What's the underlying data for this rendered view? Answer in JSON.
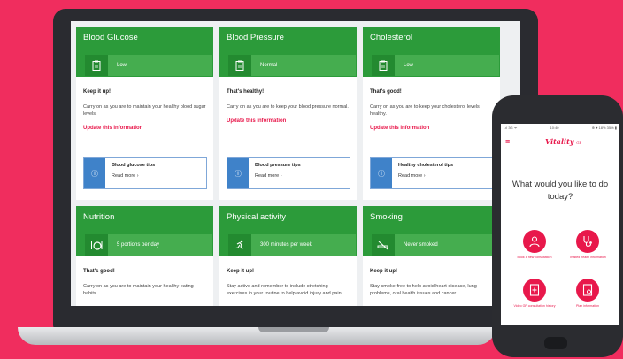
{
  "colors": {
    "background": "#f02d5e",
    "green": "#2c9b3a",
    "accent": "#e8184b",
    "tip_blue": "#3f82c9"
  },
  "cards": [
    {
      "title": "Blood Glucose",
      "status": "Low",
      "icon": "clipboard-icon",
      "msg_title": "Keep it up!",
      "msg_text": "Carry on as you are to maintain your healthy blood sugar levels.",
      "update": "Update this information",
      "tip_title": "Blood glucose tips",
      "tip_link": "Read more ›"
    },
    {
      "title": "Blood Pressure",
      "status": "Normal",
      "icon": "clipboard-icon",
      "msg_title": "That's healthy!",
      "msg_text": "Carry on as you are to keep your blood pressure normal.",
      "update": "Update this information",
      "tip_title": "Blood pressure tips",
      "tip_link": "Read more ›"
    },
    {
      "title": "Cholesterol",
      "status": "Low",
      "icon": "clipboard-icon",
      "msg_title": "That's good!",
      "msg_text": "Carry on as you are to keep your cholesterol levels healthy.",
      "update": "Update this information",
      "tip_title": "Healthy cholesterol tips",
      "tip_link": "Read more ›"
    },
    {
      "title": "Nutrition",
      "status": "5 portions per day",
      "icon": "plate-icon",
      "msg_title": "That's good!",
      "msg_text": "Carry on as you are to maintain your healthy eating habits."
    },
    {
      "title": "Physical activity",
      "status": "300 minutes per week",
      "icon": "runner-icon",
      "msg_title": "Keep it up!",
      "msg_text": "Stay active and remember to include stretching exercises in your routine to help avoid injury and pain."
    },
    {
      "title": "Smoking",
      "status": "Never smoked",
      "icon": "no-smoking-icon",
      "msg_title": "Keep it up!",
      "msg_text": "Stay smoke-free to help avoid heart disease, lung problems, oral health issues and cancer."
    }
  ],
  "phone": {
    "status_left": "..ıl 3G ᯤ",
    "status_center": "10:40",
    "status_right": "⊕ ♥ 18% 35% ▮",
    "logo": "Vitality",
    "logo_suffix": "GP",
    "question": "What would you like to do today?",
    "actions": [
      {
        "label": "Book a new consultation",
        "icon": "doctor-icon"
      },
      {
        "label": "Trusted health information",
        "icon": "stethoscope-icon"
      },
      {
        "label": "Video GP consultation history",
        "icon": "history-icon"
      },
      {
        "label": "Plan information",
        "icon": "plan-icon"
      }
    ]
  }
}
